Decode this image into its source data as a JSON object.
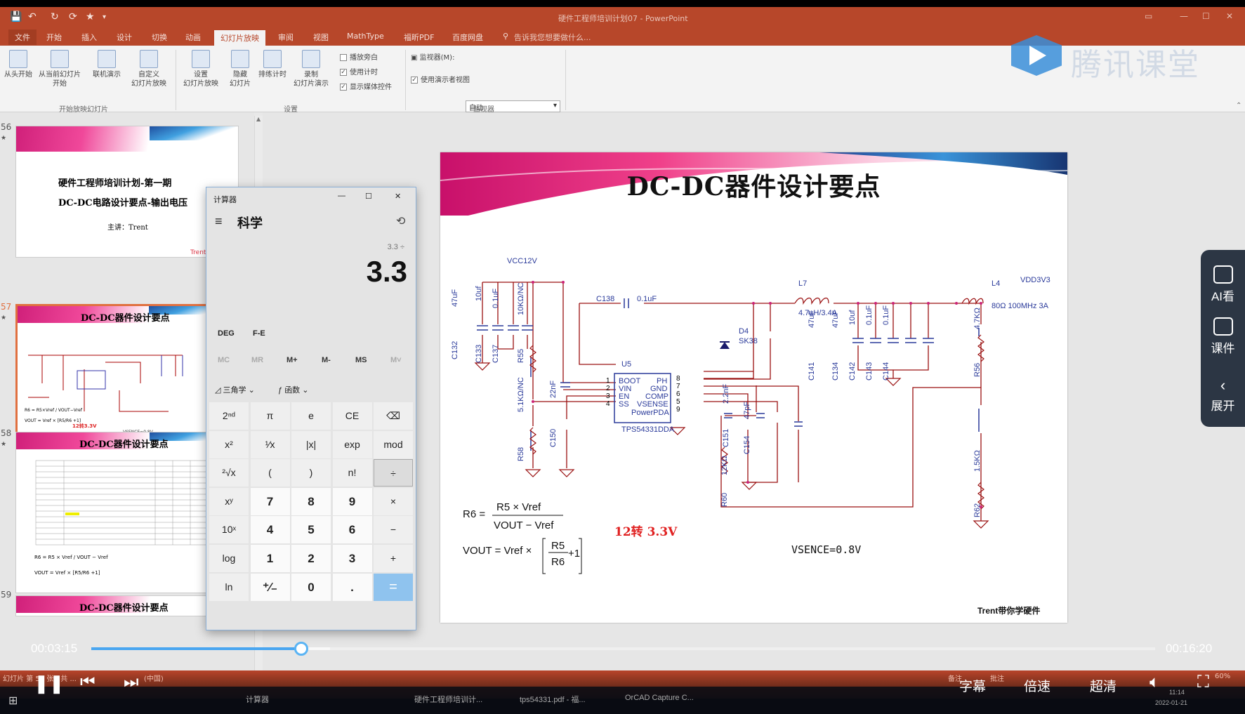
{
  "window": {
    "title": "硬件工程师培训计划07 - PowerPoint",
    "share_label": "共享"
  },
  "quick_access": [
    "💾",
    "↶",
    "↻",
    "⟳",
    "★",
    "▾"
  ],
  "tabs": [
    {
      "label": "文件",
      "active": false
    },
    {
      "label": "开始",
      "active": false
    },
    {
      "label": "插入",
      "active": false
    },
    {
      "label": "设计",
      "active": false
    },
    {
      "label": "切换",
      "active": false
    },
    {
      "label": "动画",
      "active": false
    },
    {
      "label": "幻灯片放映",
      "active": true
    },
    {
      "label": "审阅",
      "active": false
    },
    {
      "label": "视图",
      "active": false
    },
    {
      "label": "MathType",
      "active": false
    },
    {
      "label": "福昕PDF",
      "active": false
    },
    {
      "label": "百度网盘",
      "active": false
    }
  ],
  "tell_me": "告诉我您想要做什么...",
  "ribbon": {
    "group_start": {
      "buttons": [
        "从头开始",
        "从当前幻灯片\n开始",
        "联机演示",
        "自定义\n幻灯片放映"
      ],
      "name": "开始放映幻灯片"
    },
    "group_setup": {
      "buttons": [
        "设置\n幻灯片放映",
        "隐藏\n幻灯片",
        "排练计时",
        "录制\n幻灯片演示"
      ],
      "checkboxes": [
        {
          "label": "播放旁白",
          "checked": false
        },
        {
          "label": "使用计时",
          "checked": true
        },
        {
          "label": "显示媒体控件",
          "checked": true
        }
      ],
      "name": "设置"
    },
    "group_monitor": {
      "monitor_label": "监视器(M):",
      "monitor_value": "自动",
      "presenter_view": "使用演示者视图",
      "name": "监视器"
    }
  },
  "watermark": "腾讯课堂",
  "thumbnails": [
    {
      "num": "56",
      "lines": [
        "硬件工程师培训计划-第一期",
        "DC-DC电路设计要点-输出电压",
        "主讲：Trent"
      ],
      "corner": "Trent带你"
    },
    {
      "num": "57",
      "title": "DC-DC器件设计要点",
      "label": "12转3.3V",
      "vsence": "VSENCE=0.8V"
    },
    {
      "num": "58",
      "title": "DC-DC器件设计要点"
    },
    {
      "num": "59",
      "title": "DC-DC器件设计要点"
    }
  ],
  "calculator": {
    "app_title": "计算器",
    "mode": "科学",
    "expression": "3.3 ÷",
    "display": "3.3",
    "angle_mode": "DEG",
    "fe": "F-E",
    "memory": [
      {
        "label": "MC",
        "enabled": false
      },
      {
        "label": "MR",
        "enabled": false
      },
      {
        "label": "M+",
        "enabled": true
      },
      {
        "label": "M-",
        "enabled": true
      },
      {
        "label": "MS",
        "enabled": true
      },
      {
        "label": "M˅",
        "enabled": false
      }
    ],
    "trig_label": "三角学",
    "func_label": "函数",
    "keys": [
      [
        "2ⁿᵈ",
        "π",
        "e",
        "CE",
        "⌫"
      ],
      [
        "x²",
        "¹⁄x",
        "|x|",
        "exp",
        "mod"
      ],
      [
        "²√x",
        "(",
        ")",
        "n!",
        "÷"
      ],
      [
        "xʸ",
        "7",
        "8",
        "9",
        "×"
      ],
      [
        "10ˣ",
        "4",
        "5",
        "6",
        "−"
      ],
      [
        "log",
        "1",
        "2",
        "3",
        "+"
      ],
      [
        "ln",
        "⁺∕₋",
        "0",
        ".",
        "="
      ]
    ],
    "window_buttons": [
      "—",
      "☐",
      "✕"
    ]
  },
  "slide": {
    "title": "DC-DC器件设计要点",
    "schematic": {
      "labels": {
        "vcc": "VCC12V",
        "vdd": "VDD3V3",
        "L7": "L7",
        "L7_val": "4.7uH/3.4A",
        "L4": "L4",
        "L4_val": "80Ω 100MHz 3A",
        "C138": "C138",
        "C138_val": "0.1uF",
        "U5": "U5",
        "part": "TPS54331DDA",
        "package": "PowerPDA",
        "D4": "D4",
        "D4_val": "SK38",
        "pins_left": [
          "BOOT",
          "VIN",
          "EN",
          "SS"
        ],
        "pins_right": [
          "PH",
          "GND",
          "COMP",
          "VSENSE"
        ],
        "pin_nums_left": [
          "1",
          "2",
          "3",
          "4"
        ],
        "pin_nums_right": [
          "8",
          "7",
          "6",
          "5"
        ],
        "pin9": "9",
        "C132": "C132",
        "C133": "C133",
        "C137": "C137",
        "c_vals_in": [
          "47uF",
          "10uf",
          "0.1uF"
        ],
        "R55": "R55",
        "R55_val": "10KΩ/NC",
        "R58": "R58",
        "R58_val": "5.1KΩ/NC",
        "C150": "C150",
        "C150_val": "22nF",
        "C151": "C151",
        "C151_val": "2.2nF",
        "R60": "R60",
        "R60_val": "12KΩ",
        "C154": "C154",
        "C154_val": "47pF",
        "out_caps": [
          "C141",
          "C134",
          "C142",
          "C143",
          "C144"
        ],
        "out_vals": [
          "47uF",
          "47uF",
          "10uf",
          "0.1uF",
          "0.1uF"
        ],
        "R56": "R56",
        "R56_val": "4.7KΩ",
        "R62": "R62",
        "R62_val": "1.5KΩ"
      },
      "formula1_lhs": "R6 =",
      "formula1_num": "R5 × Vref",
      "formula1_den": "VOUT − Vref",
      "formula2_lhs": "VOUT = Vref ×",
      "formula2_frac_num": "R5",
      "formula2_frac_den": "R6",
      "formula2_plus": "+1",
      "conversion": "12转 3.3V",
      "vsence": "VSENCE=0.8V",
      "signature": "Trent带你学硬件"
    }
  },
  "player": {
    "current_time": "00:03:15",
    "total_time": "00:16:20",
    "progress_fraction": 0.198,
    "controls": {
      "subtitles": "字幕",
      "speed": "倍速",
      "quality": "超清"
    }
  },
  "side_panel": [
    {
      "icon": "ai-view-icon",
      "label": "AI看"
    },
    {
      "icon": "courseware-icon",
      "label": "课件"
    },
    {
      "icon": "chevron-left-icon",
      "label": "展开"
    }
  ],
  "taskbar": {
    "items": [
      "计算器",
      "硬件工程师培训计...",
      "tps54331.pdf - 福...",
      "OrCAD Capture C..."
    ],
    "date": "2022-01-21",
    "time": "11:14"
  },
  "statusbar": {
    "left": "幻灯片 第 57 张，共 ...",
    "lang": "(中国)",
    "notes": "备注",
    "comments": "批注",
    "zoom": "60%"
  }
}
